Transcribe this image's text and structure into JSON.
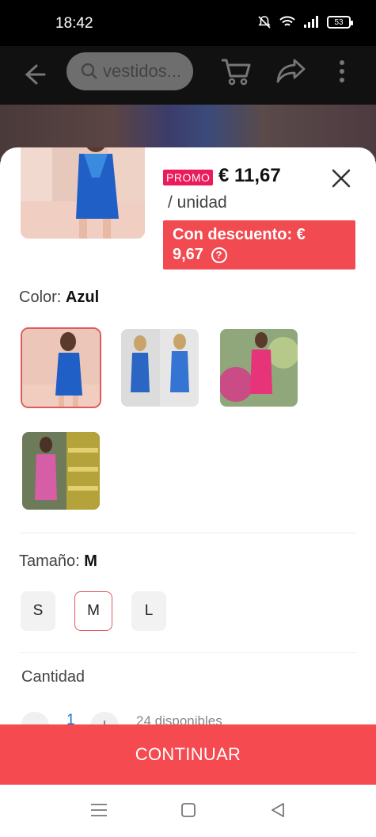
{
  "status": {
    "time": "18:42",
    "battery": "53"
  },
  "search": {
    "placeholder": "vestidos..."
  },
  "product": {
    "promo_badge": "PROMO",
    "price": "€ 11,67",
    "unit": "/ unidad",
    "discount_label": "Con descuento: €",
    "discount_value": "9,67",
    "discount_help_icon": "?"
  },
  "color": {
    "label": "Color: ",
    "selected": "Azul",
    "options": [
      {
        "name": "azul-1",
        "color": "#2a5fb8"
      },
      {
        "name": "azul-2",
        "color": "#3a6fc0"
      },
      {
        "name": "rosa-1",
        "color": "#e33a78"
      },
      {
        "name": "rosa-2",
        "color": "#d45aa0"
      }
    ]
  },
  "size": {
    "label": "Tamaño: ",
    "selected": "M",
    "options": [
      "S",
      "M",
      "L"
    ]
  },
  "quantity": {
    "label": "Cantidad",
    "value": "1",
    "minus": "−",
    "plus": "+",
    "stock": "24 disponibles"
  },
  "actions": {
    "continue": "CONTINUAR"
  },
  "colors": {
    "accent": "#f44a50",
    "promo": "#ec1b5b",
    "selected_border": "#e05a5f"
  }
}
